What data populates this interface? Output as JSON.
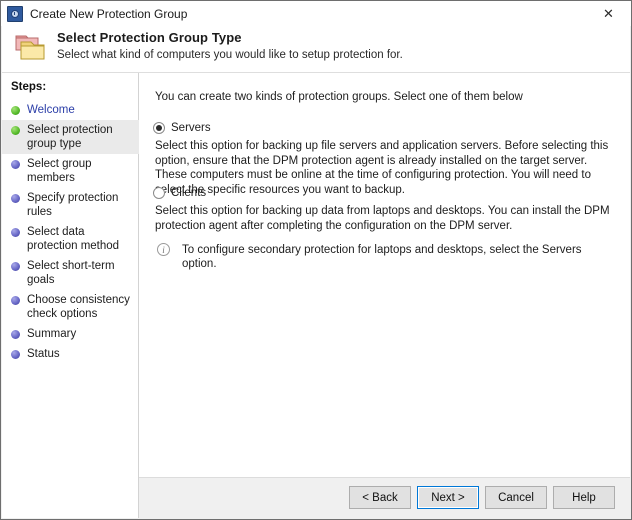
{
  "window": {
    "title": "Create New Protection Group",
    "title_icon": "dpm-clock-icon",
    "close_label": "✕"
  },
  "header": {
    "icon": "folder-icon",
    "title": "Select Protection Group Type",
    "subtitle": "Select what kind of computers you would like to setup protection for."
  },
  "sidebar": {
    "label": "Steps:",
    "items": [
      {
        "label": "Welcome",
        "state": "done",
        "bullet": "green",
        "selected": false,
        "link": true
      },
      {
        "label": "Select protection group type",
        "state": "current",
        "bullet": "green",
        "selected": true,
        "link": false
      },
      {
        "label": "Select group members",
        "state": "pending",
        "bullet": "blue",
        "selected": false,
        "link": false
      },
      {
        "label": "Specify protection rules",
        "state": "pending",
        "bullet": "blue",
        "selected": false,
        "link": false
      },
      {
        "label": "Select data protection method",
        "state": "pending",
        "bullet": "blue",
        "selected": false,
        "link": false
      },
      {
        "label": "Select short-term goals",
        "state": "pending",
        "bullet": "blue",
        "selected": false,
        "link": false
      },
      {
        "label": "Choose consistency check options",
        "state": "pending",
        "bullet": "blue",
        "selected": false,
        "link": false
      },
      {
        "label": "Summary",
        "state": "pending",
        "bullet": "blue",
        "selected": false,
        "link": false
      },
      {
        "label": "Status",
        "state": "pending",
        "bullet": "blue",
        "selected": false,
        "link": false
      }
    ]
  },
  "main": {
    "intro": "You can create two kinds of protection groups. Select one of them below",
    "options": [
      {
        "id": "servers",
        "label": "Servers",
        "checked": true,
        "description": "Select this option for backing up file servers and application servers. Before selecting this option, ensure that the DPM protection agent is already installed on the target server. These computers must be online at the time of configuring protection. You will need to select the specific resources you want to backup."
      },
      {
        "id": "clients",
        "label": "Clients",
        "checked": false,
        "description": "Select this option for backing up data from laptops and desktops. You can install the DPM protection agent after completing the configuration on the DPM server."
      }
    ],
    "note": {
      "icon": "info-icon",
      "text": "To configure secondary protection for laptops and desktops, select the Servers option."
    }
  },
  "footer": {
    "buttons": [
      {
        "id": "back",
        "label": "< Back",
        "default": false
      },
      {
        "id": "next",
        "label": "Next >",
        "default": true
      },
      {
        "id": "cancel",
        "label": "Cancel",
        "default": false
      },
      {
        "id": "help",
        "label": "Help",
        "default": false
      }
    ]
  },
  "colors": {
    "accent": "#0078d7",
    "link": "#2b3ea8",
    "step_done": "#5bbf2e",
    "step_pending": "#6a6ac8"
  }
}
